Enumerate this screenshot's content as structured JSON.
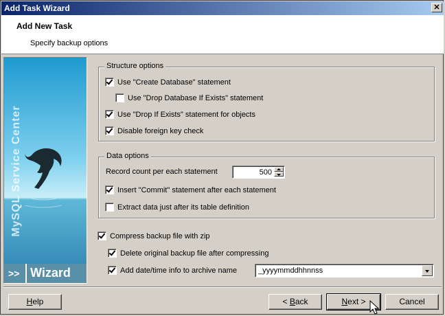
{
  "window": {
    "title": "Add Task Wizard"
  },
  "header": {
    "title": "Add New Task",
    "subtitle": "Specify backup options"
  },
  "banner": {
    "vertical_text": "MySQL Service Center",
    "arrows": ">>",
    "word": "Wizard"
  },
  "structure": {
    "label": "Structure options",
    "options": [
      {
        "label": "Use \"Create Database\" statement",
        "checked": true
      },
      {
        "label": "Use \"Drop Database If Exists\" statement",
        "checked": false
      },
      {
        "label": "Use \"Drop If Exists\" statement for objects",
        "checked": true
      },
      {
        "label": "Disable foreign key check",
        "checked": true
      }
    ]
  },
  "data_options": {
    "label": "Data options",
    "record_count_label": "Record count per each statement",
    "record_count_value": "500",
    "options": [
      {
        "label": "Insert \"Commit\" statement after each statement",
        "checked": true
      },
      {
        "label": "Extract data just after its table definition",
        "checked": false
      }
    ]
  },
  "compress": {
    "label": "Compress backup file with zip",
    "checked": true,
    "delete_label": "Delete original backup file after compressing",
    "delete_checked": true,
    "datetime_label": "Add date/time info to archive name",
    "datetime_checked": true,
    "format_value": "_yyyymmddhhnnss"
  },
  "buttons": {
    "help": {
      "u": "H",
      "rest": "elp"
    },
    "back": {
      "prefix": "< ",
      "u": "B",
      "rest": "ack"
    },
    "next": {
      "u": "N",
      "rest": "ext >"
    },
    "cancel": "Cancel"
  }
}
